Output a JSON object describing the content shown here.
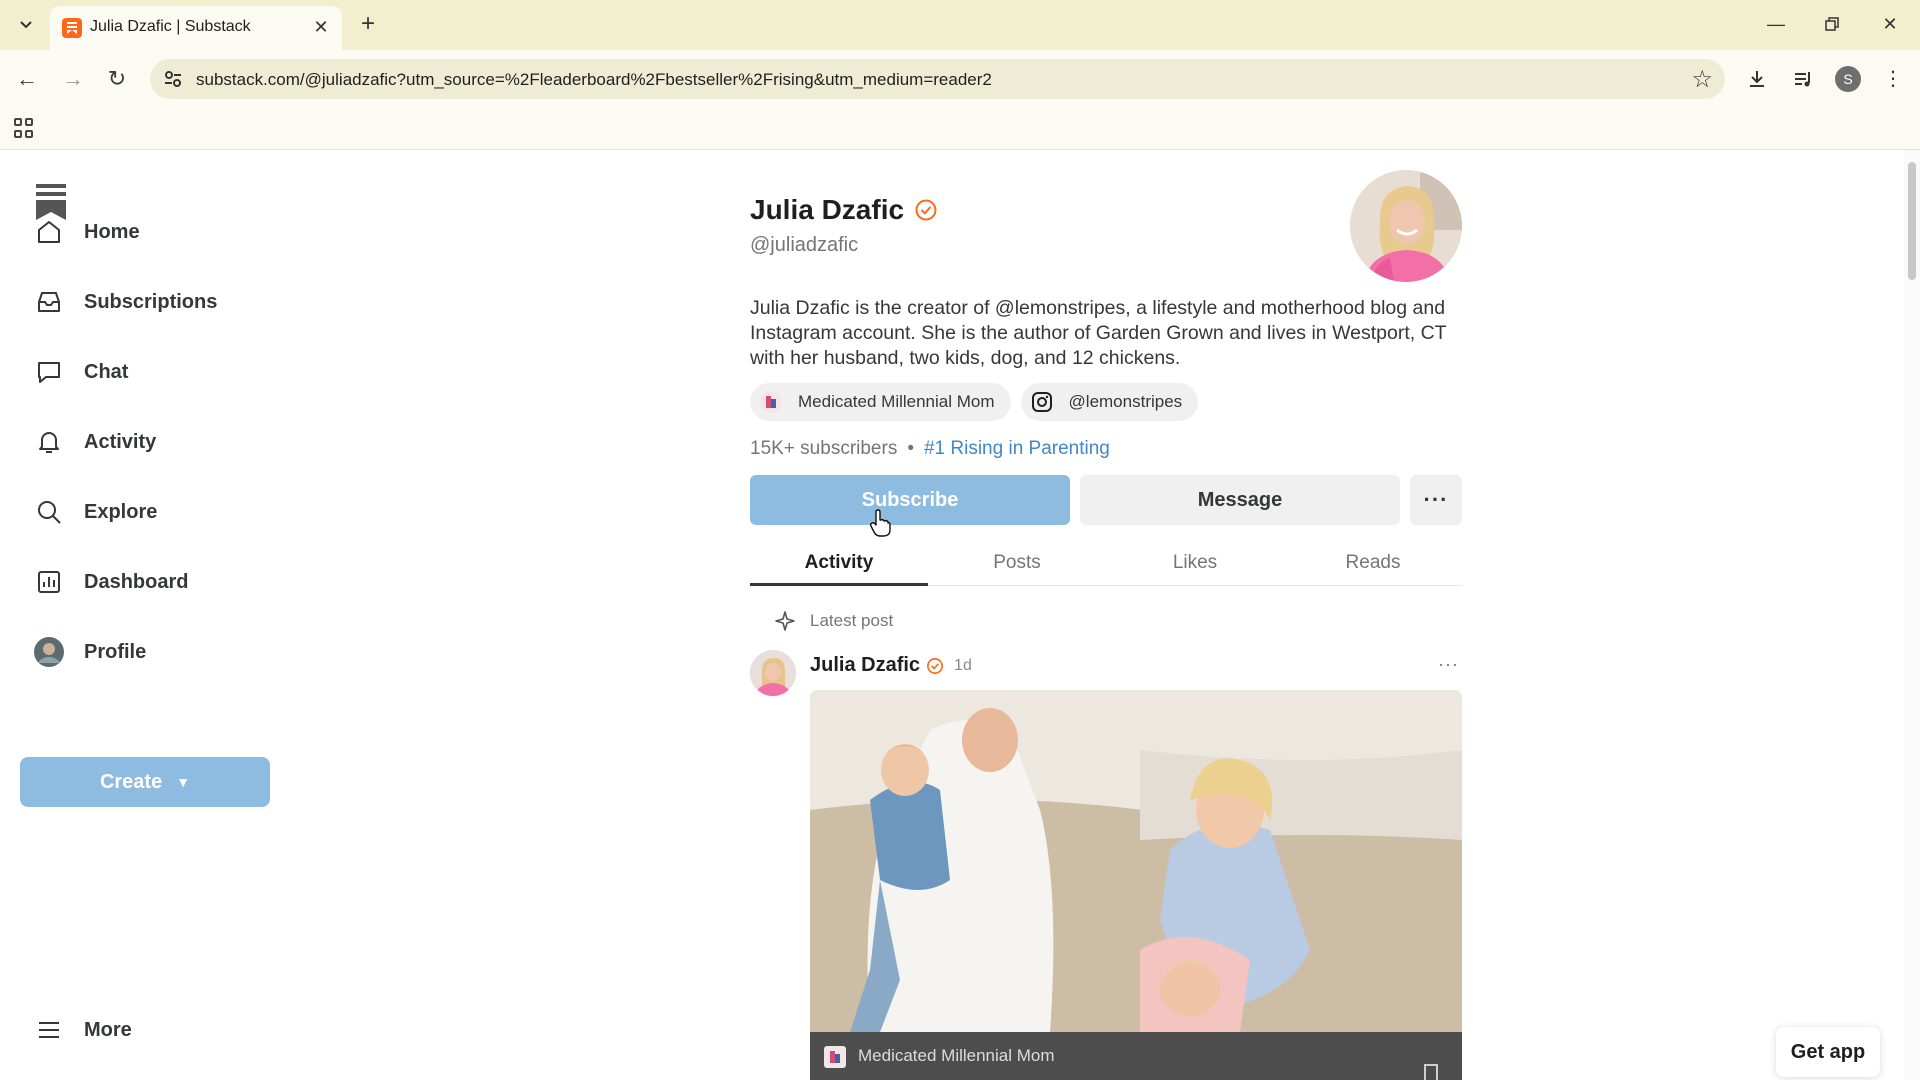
{
  "browser": {
    "tab_title": "Julia Dzafic | Substack",
    "url": "substack.com/@juliadzafic?utm_source=%2Fleaderboard%2Fbestseller%2Frising&utm_medium=reader2",
    "profile_initial": "S"
  },
  "sidebar": {
    "items": [
      {
        "label": "Home",
        "icon": "home-icon"
      },
      {
        "label": "Subscriptions",
        "icon": "inbox-icon"
      },
      {
        "label": "Chat",
        "icon": "chat-icon"
      },
      {
        "label": "Activity",
        "icon": "bell-icon"
      },
      {
        "label": "Explore",
        "icon": "search-icon"
      },
      {
        "label": "Dashboard",
        "icon": "chart-icon"
      },
      {
        "label": "Profile",
        "icon": "avatar"
      }
    ],
    "create_label": "Create",
    "more_label": "More"
  },
  "profile": {
    "name": "Julia Dzafic",
    "handle": "@juliadzafic",
    "bio": "Julia Dzafic is the creator of @lemonstripes, a lifestyle and motherhood blog and Instagram account. She is the author of Garden Grown and lives in Westport, CT with her husband, two kids, dog, and 12 chickens.",
    "chips": [
      {
        "label": "Medicated Millennial Mom",
        "icon": "publication-icon"
      },
      {
        "label": "@lemonstripes",
        "icon": "instagram-icon"
      }
    ],
    "subscribers": "15K+ subscribers",
    "separator": "•",
    "rank": "#1 Rising in Parenting",
    "subscribe_label": "Subscribe",
    "message_label": "Message",
    "more_label": "···"
  },
  "tabs": [
    "Activity",
    "Posts",
    "Likes",
    "Reads"
  ],
  "feed": {
    "latest_label": "Latest post",
    "post": {
      "author": "Julia Dzafic",
      "time": "1d",
      "publication": "Medicated Millennial Mom",
      "more": "···"
    }
  },
  "get_app_label": "Get app",
  "colors": {
    "accent_blue": "#8dbce0",
    "link_blue": "#3f87c6",
    "verified_orange": "#ff6719",
    "chrome_bg": "#f2efcf"
  }
}
